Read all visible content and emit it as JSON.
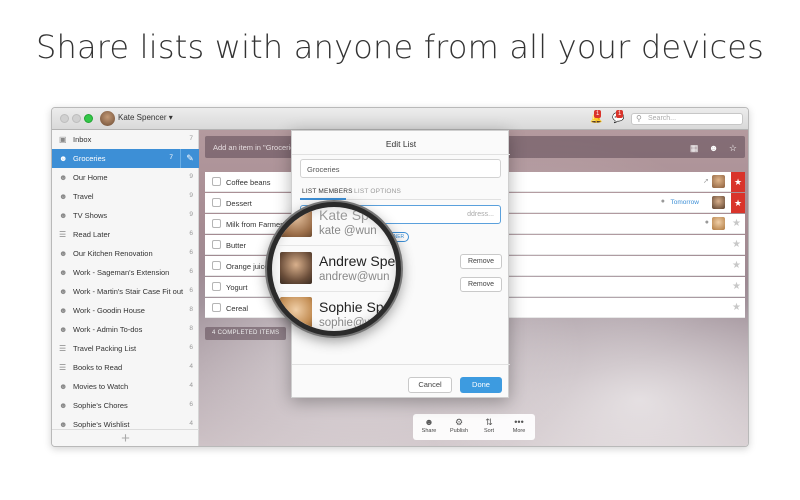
{
  "headline": "Share lists with anyone from all your devices",
  "titlebar": {
    "user_name": "Kate Spencer ▾",
    "notif_badge_1": "1",
    "notif_badge_2": "1",
    "search_placeholder": "Search..."
  },
  "sidebar": {
    "items": [
      {
        "label": "Inbox",
        "count": "7",
        "icon": "inbox-icon"
      },
      {
        "label": "Groceries",
        "count": "7",
        "icon": "shared-list-icon"
      },
      {
        "label": "Our Home",
        "count": "9",
        "icon": "shared-list-icon"
      },
      {
        "label": "Travel",
        "count": "9",
        "icon": "shared-list-icon"
      },
      {
        "label": "TV Shows",
        "count": "9",
        "icon": "shared-list-icon"
      },
      {
        "label": "Read Later",
        "count": "6",
        "icon": "list-icon"
      },
      {
        "label": "Our Kitchen Renovation",
        "count": "6",
        "icon": "shared-list-icon"
      },
      {
        "label": "Work - Sageman's Extension",
        "count": "6",
        "icon": "shared-list-icon"
      },
      {
        "label": "Work - Martin's Stair Case Fit out",
        "count": "6",
        "icon": "shared-list-icon"
      },
      {
        "label": "Work - Goodin House",
        "count": "8",
        "icon": "shared-list-icon"
      },
      {
        "label": "Work - Admin To-dos",
        "count": "8",
        "icon": "shared-list-icon"
      },
      {
        "label": "Travel Packing List",
        "count": "6",
        "icon": "list-icon"
      },
      {
        "label": "Books to Read",
        "count": "4",
        "icon": "list-icon"
      },
      {
        "label": "Movies to Watch",
        "count": "4",
        "icon": "shared-list-icon"
      },
      {
        "label": "Sophie's Chores",
        "count": "6",
        "icon": "shared-list-icon"
      },
      {
        "label": "Sophie's Wishlist",
        "count": "4",
        "icon": "shared-list-icon"
      }
    ],
    "add_label": "+"
  },
  "main": {
    "add_placeholder": "Add an item in \"Groceries\"...",
    "tasks": [
      {
        "label": "Coffee beans"
      },
      {
        "label": "Dessert",
        "due": "Tomorrow"
      },
      {
        "label": "Milk from Farmer's M"
      },
      {
        "label": "Butter"
      },
      {
        "label": "Orange juice"
      },
      {
        "label": "Yogurt"
      },
      {
        "label": "Cereal"
      }
    ],
    "completed_label": "4 COMPLETED ITEMS",
    "toolbar": [
      {
        "label": "Share",
        "icon": "share-icon"
      },
      {
        "label": "Publish",
        "icon": "publish-icon"
      },
      {
        "label": "Sort",
        "icon": "sort-icon"
      },
      {
        "label": "More",
        "icon": "more-icon"
      }
    ]
  },
  "dialog": {
    "title": "Edit List",
    "list_name": "Groceries",
    "tab_members": "LIST MEMBERS",
    "tab_options": "LIST OPTIONS",
    "email_placeholder": "ddress...",
    "owner_badge": "OWNER",
    "remove_label": "Remove",
    "cancel_label": "Cancel",
    "done_label": "Done"
  },
  "magnifier": {
    "members": [
      {
        "name": "Kate Spe",
        "email": "kate @wun"
      },
      {
        "name": "Andrew Spe",
        "email": "andrew@wun"
      },
      {
        "name": "Sophie Sp",
        "email": "sophie@wu"
      }
    ]
  },
  "colors": {
    "accent": "#3d8fd6",
    "star_red": "#d9342b",
    "done_blue": "#3d9be0"
  }
}
